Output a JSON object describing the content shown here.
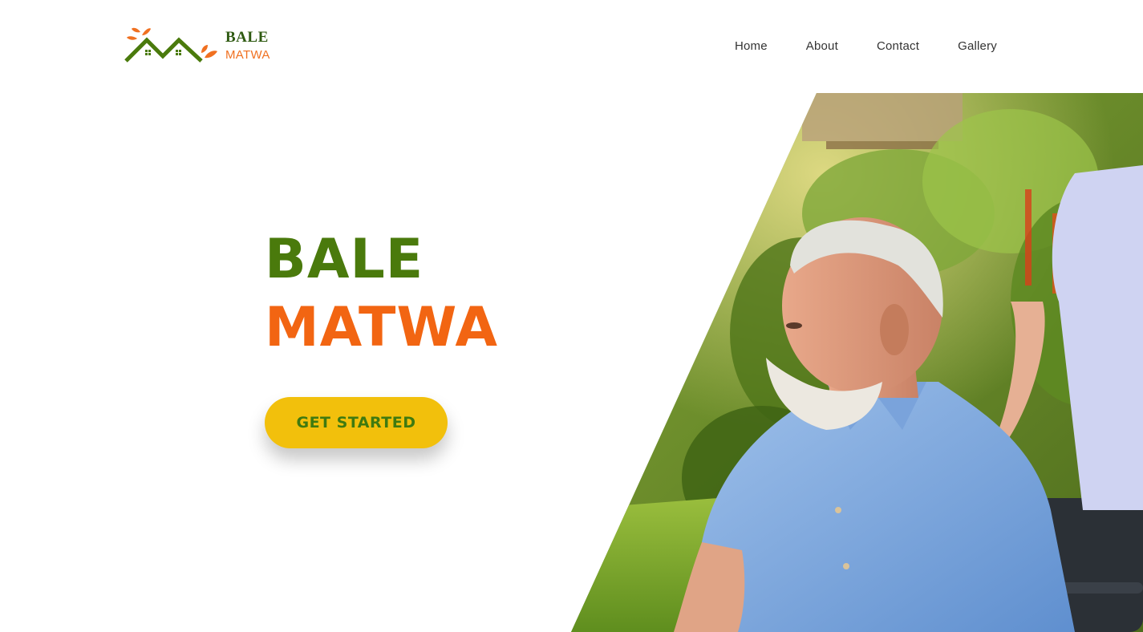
{
  "header": {
    "logo": {
      "line1": "BALE",
      "line2": "MATWA",
      "icon": "house-roofs-leaves-logo"
    },
    "nav": [
      {
        "label": "Home"
      },
      {
        "label": "About"
      },
      {
        "label": "Contact"
      },
      {
        "label": "Gallery"
      }
    ]
  },
  "hero": {
    "title_line1": "BALE",
    "title_line2": "MATWA",
    "cta_label": "GET STARTED",
    "image": "elderly-man-in-wheelchair-with-nurse-photo"
  },
  "colors": {
    "brand_green": "#4a7a0c",
    "brand_orange": "#f26512",
    "cta_yellow": "#f2c00c",
    "logo_dark_green": "#2f5a12"
  }
}
